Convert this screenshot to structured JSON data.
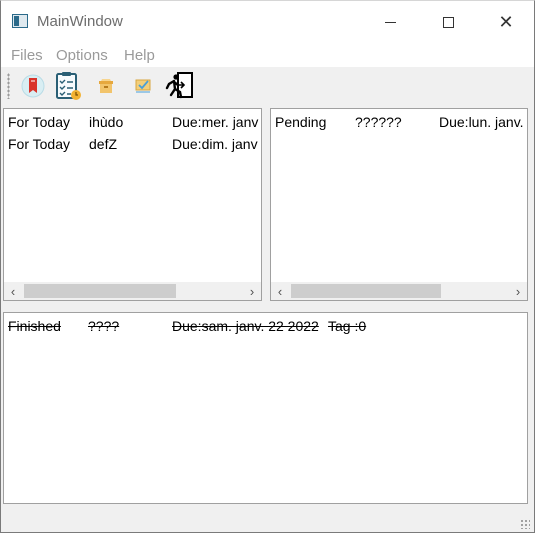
{
  "window": {
    "title": "MainWindow",
    "controls": {
      "minimize": "minimize-icon",
      "maximize": "maximize-icon",
      "close": "close-icon"
    }
  },
  "menu": [
    {
      "label": "Files"
    },
    {
      "label": "Options"
    },
    {
      "label": "Help"
    }
  ],
  "toolbar": [
    {
      "icon": "bookmark-icon"
    },
    {
      "icon": "clipboard-checklist-icon"
    },
    {
      "icon": "archive-box-icon"
    },
    {
      "icon": "checked-box-icon"
    },
    {
      "icon": "exit-running-man-icon"
    }
  ],
  "lists": {
    "today": {
      "rows": [
        {
          "status": "For Today",
          "name": "ihùdo",
          "due": "Due:mer. janv"
        },
        {
          "status": "For Today",
          "name": "defZ",
          "due": "Due:dim. janv"
        }
      ]
    },
    "pending": {
      "rows": [
        {
          "status": "Pending",
          "name": "??????",
          "due": "Due:lun. janv."
        }
      ]
    },
    "finished": {
      "rows": [
        {
          "status": "Finished",
          "name": "????",
          "due": "Due:sam. janv. 22 2022",
          "tag": "Tag :0"
        }
      ]
    }
  },
  "scrollbars": {
    "left_arrow": "‹",
    "right_arrow": "›"
  }
}
